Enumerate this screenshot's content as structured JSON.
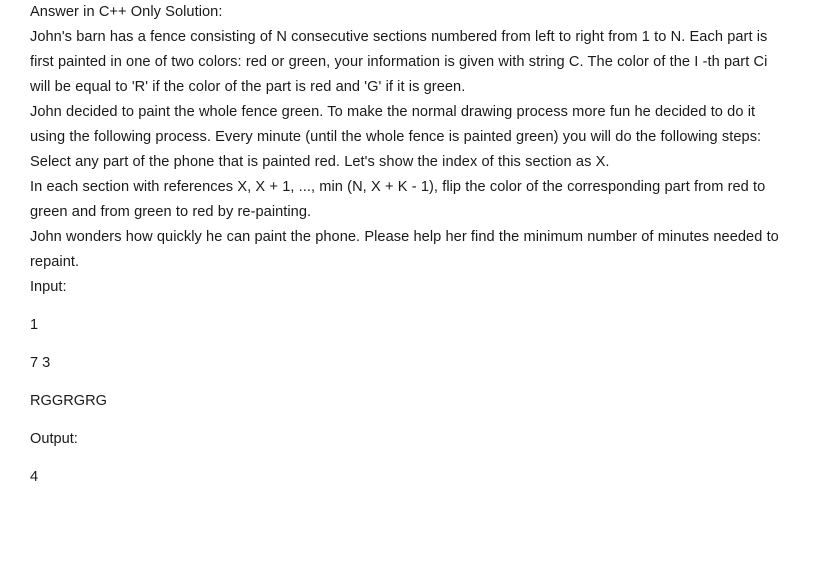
{
  "document": {
    "heading": "Answer in C++ Only Solution:",
    "paragraphs": [
      "John's barn has a fence consisting of N consecutive sections numbered from left to right from 1 to N. Each part is first painted in one of two colors: red or green, your information is given with string C. The color of the I -th part Ci will be equal to 'R' if the color of the part is red and 'G' if it is green.",
      "John decided to paint the whole fence green. To make the normal drawing process more fun he decided to do it using the following process. Every minute (until the whole fence is painted green) you will do the following steps:",
      "Select any part of the phone that is painted red. Let's show the index of this section as X.",
      "In each section with references X, X + 1, ..., min (N, X + K - 1), flip the color of the corresponding part from red to green and from green to red by re-painting.",
      "John wonders how quickly he can paint the phone. Please help her find the minimum number of minutes needed to repaint."
    ],
    "io": {
      "input_label": "Input:",
      "input_lines": [
        "1",
        "7 3",
        "RGGRGRG"
      ],
      "output_label": "Output:",
      "output_lines": [
        "4"
      ]
    },
    "colors": {
      "text": "#1a1a1a",
      "background": "#ffffff"
    }
  }
}
